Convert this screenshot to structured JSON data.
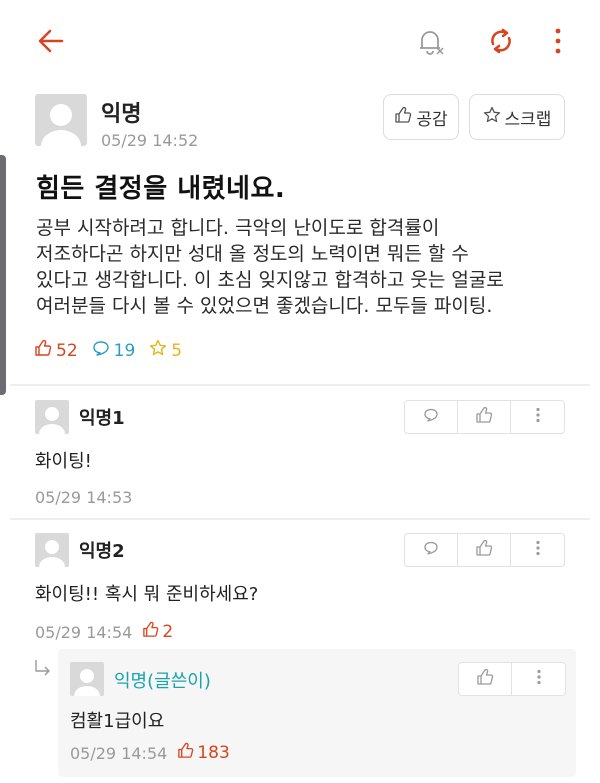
{
  "post": {
    "author": "익명",
    "time": "05/29 14:52",
    "like_button": "공감",
    "scrap_button": "스크랩",
    "title": "힘든 결정을 내렸네요.",
    "body": "공부 시작하려고 합니다. 극악의 난이도로 합격률이\n저조하다곤 하지만 성대 올 정도의 노력이면 뭐든 할 수\n있다고 생각합니다. 이 초심 잊지않고 합격하고 웃는 얼굴로\n여러분들 다시 볼 수 있었으면 좋겠습니다. 모두들 파이팅.",
    "likes": "52",
    "comments": "19",
    "scraps": "5"
  },
  "comments": [
    {
      "author": "익명1",
      "text": "화이팅!",
      "time": "05/29 14:53",
      "likes": ""
    },
    {
      "author": "익명2",
      "text": "화이팅!! 혹시 뭐 준비하세요?",
      "time": "05/29 14:54",
      "likes": "2"
    }
  ],
  "reply": {
    "author": "익명(글쓴이)",
    "text": "컴활1급이요",
    "time": "05/29 14:54",
    "likes": "183"
  },
  "colors": {
    "accent": "#d9441f",
    "comment": "#2a9dc6",
    "scrap": "#e7b41b",
    "op": "#17a4b1"
  },
  "icons": [
    "back-arrow-icon",
    "notification-off-icon",
    "refresh-icon",
    "more-vertical-icon",
    "thumbs-up-icon",
    "star-icon",
    "comment-icon"
  ]
}
